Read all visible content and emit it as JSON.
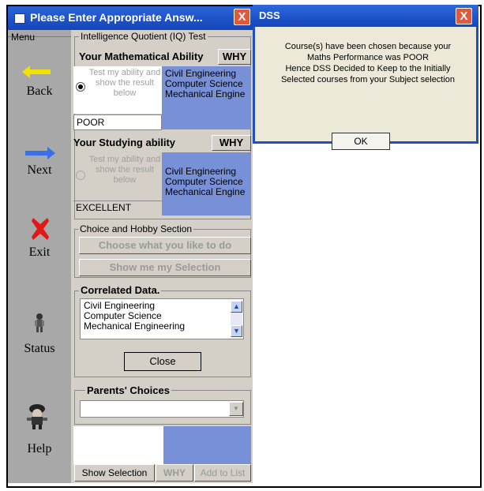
{
  "main_window": {
    "title": "Please Enter Appropriate Answ...",
    "close_label": "X"
  },
  "menu": {
    "label": "Menu",
    "items": [
      {
        "label": "Back",
        "icon": "yellow-arrow-left-icon"
      },
      {
        "label": "Next",
        "icon": "blue-arrow-right-icon"
      },
      {
        "label": "Exit",
        "icon": "red-x-icon"
      },
      {
        "label": "Status",
        "icon": "person-icon"
      },
      {
        "label": "Help",
        "icon": "character-icon"
      }
    ]
  },
  "iq": {
    "group_label": "Intelligence Quotient (IQ) Test",
    "math": {
      "title": "Your Mathematical Ability",
      "why_label": "WHY",
      "test_text": "Test my ability and show the result below",
      "result": "POOR",
      "courses": [
        "Civil Engineering",
        "Computer Science",
        "Mechanical Engine"
      ]
    },
    "study": {
      "title": "Your Studying ability",
      "why_label": "WHY",
      "test_text": "Test my ability and show the result below",
      "result": "EXCELLENT",
      "courses": [
        "Civil Engineering",
        "Computer Science",
        "Mechanical Engine"
      ]
    }
  },
  "choice": {
    "group_label": "Choice and Hobby Section",
    "choose_button": "Choose what you like to do",
    "show_button": "Show me my Selection"
  },
  "correlated": {
    "title": "Correlated Data.",
    "items": [
      "Civil Engineering",
      "Computer Science",
      "Mechanical Engineering"
    ],
    "close_button": "Close"
  },
  "parents": {
    "title": "Parents' Choices",
    "selected": ""
  },
  "bottom": {
    "show_selection": "Show Selection",
    "why": "WHY",
    "add_to_list": "Add to List"
  },
  "dss": {
    "title": "DSS",
    "close_label": "X",
    "message_lines": [
      "Course(s) have been chosen because your",
      "Maths Performance was  POOR",
      "Hence DSS Decided to Keep to the Initially",
      "Selected courses from your Subject selection"
    ],
    "ok_label": "OK"
  }
}
